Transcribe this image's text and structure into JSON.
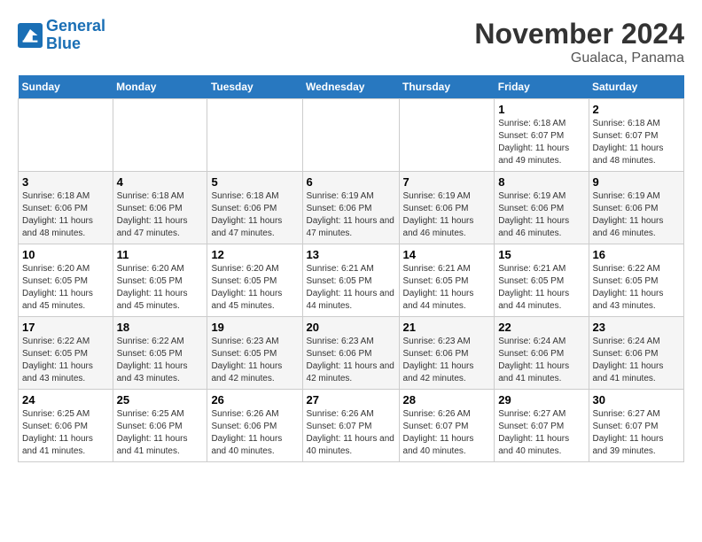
{
  "logo": {
    "text_general": "General",
    "text_blue": "Blue"
  },
  "header": {
    "month_year": "November 2024",
    "location": "Gualaca, Panama"
  },
  "days_of_week": [
    "Sunday",
    "Monday",
    "Tuesday",
    "Wednesday",
    "Thursday",
    "Friday",
    "Saturday"
  ],
  "weeks": [
    [
      {
        "day": "",
        "info": ""
      },
      {
        "day": "",
        "info": ""
      },
      {
        "day": "",
        "info": ""
      },
      {
        "day": "",
        "info": ""
      },
      {
        "day": "",
        "info": ""
      },
      {
        "day": "1",
        "info": "Sunrise: 6:18 AM\nSunset: 6:07 PM\nDaylight: 11 hours and 49 minutes."
      },
      {
        "day": "2",
        "info": "Sunrise: 6:18 AM\nSunset: 6:07 PM\nDaylight: 11 hours and 48 minutes."
      }
    ],
    [
      {
        "day": "3",
        "info": "Sunrise: 6:18 AM\nSunset: 6:06 PM\nDaylight: 11 hours and 48 minutes."
      },
      {
        "day": "4",
        "info": "Sunrise: 6:18 AM\nSunset: 6:06 PM\nDaylight: 11 hours and 47 minutes."
      },
      {
        "day": "5",
        "info": "Sunrise: 6:18 AM\nSunset: 6:06 PM\nDaylight: 11 hours and 47 minutes."
      },
      {
        "day": "6",
        "info": "Sunrise: 6:19 AM\nSunset: 6:06 PM\nDaylight: 11 hours and 47 minutes."
      },
      {
        "day": "7",
        "info": "Sunrise: 6:19 AM\nSunset: 6:06 PM\nDaylight: 11 hours and 46 minutes."
      },
      {
        "day": "8",
        "info": "Sunrise: 6:19 AM\nSunset: 6:06 PM\nDaylight: 11 hours and 46 minutes."
      },
      {
        "day": "9",
        "info": "Sunrise: 6:19 AM\nSunset: 6:06 PM\nDaylight: 11 hours and 46 minutes."
      }
    ],
    [
      {
        "day": "10",
        "info": "Sunrise: 6:20 AM\nSunset: 6:05 PM\nDaylight: 11 hours and 45 minutes."
      },
      {
        "day": "11",
        "info": "Sunrise: 6:20 AM\nSunset: 6:05 PM\nDaylight: 11 hours and 45 minutes."
      },
      {
        "day": "12",
        "info": "Sunrise: 6:20 AM\nSunset: 6:05 PM\nDaylight: 11 hours and 45 minutes."
      },
      {
        "day": "13",
        "info": "Sunrise: 6:21 AM\nSunset: 6:05 PM\nDaylight: 11 hours and 44 minutes."
      },
      {
        "day": "14",
        "info": "Sunrise: 6:21 AM\nSunset: 6:05 PM\nDaylight: 11 hours and 44 minutes."
      },
      {
        "day": "15",
        "info": "Sunrise: 6:21 AM\nSunset: 6:05 PM\nDaylight: 11 hours and 44 minutes."
      },
      {
        "day": "16",
        "info": "Sunrise: 6:22 AM\nSunset: 6:05 PM\nDaylight: 11 hours and 43 minutes."
      }
    ],
    [
      {
        "day": "17",
        "info": "Sunrise: 6:22 AM\nSunset: 6:05 PM\nDaylight: 11 hours and 43 minutes."
      },
      {
        "day": "18",
        "info": "Sunrise: 6:22 AM\nSunset: 6:05 PM\nDaylight: 11 hours and 43 minutes."
      },
      {
        "day": "19",
        "info": "Sunrise: 6:23 AM\nSunset: 6:05 PM\nDaylight: 11 hours and 42 minutes."
      },
      {
        "day": "20",
        "info": "Sunrise: 6:23 AM\nSunset: 6:06 PM\nDaylight: 11 hours and 42 minutes."
      },
      {
        "day": "21",
        "info": "Sunrise: 6:23 AM\nSunset: 6:06 PM\nDaylight: 11 hours and 42 minutes."
      },
      {
        "day": "22",
        "info": "Sunrise: 6:24 AM\nSunset: 6:06 PM\nDaylight: 11 hours and 41 minutes."
      },
      {
        "day": "23",
        "info": "Sunrise: 6:24 AM\nSunset: 6:06 PM\nDaylight: 11 hours and 41 minutes."
      }
    ],
    [
      {
        "day": "24",
        "info": "Sunrise: 6:25 AM\nSunset: 6:06 PM\nDaylight: 11 hours and 41 minutes."
      },
      {
        "day": "25",
        "info": "Sunrise: 6:25 AM\nSunset: 6:06 PM\nDaylight: 11 hours and 41 minutes."
      },
      {
        "day": "26",
        "info": "Sunrise: 6:26 AM\nSunset: 6:06 PM\nDaylight: 11 hours and 40 minutes."
      },
      {
        "day": "27",
        "info": "Sunrise: 6:26 AM\nSunset: 6:07 PM\nDaylight: 11 hours and 40 minutes."
      },
      {
        "day": "28",
        "info": "Sunrise: 6:26 AM\nSunset: 6:07 PM\nDaylight: 11 hours and 40 minutes."
      },
      {
        "day": "29",
        "info": "Sunrise: 6:27 AM\nSunset: 6:07 PM\nDaylight: 11 hours and 40 minutes."
      },
      {
        "day": "30",
        "info": "Sunrise: 6:27 AM\nSunset: 6:07 PM\nDaylight: 11 hours and 39 minutes."
      }
    ]
  ]
}
